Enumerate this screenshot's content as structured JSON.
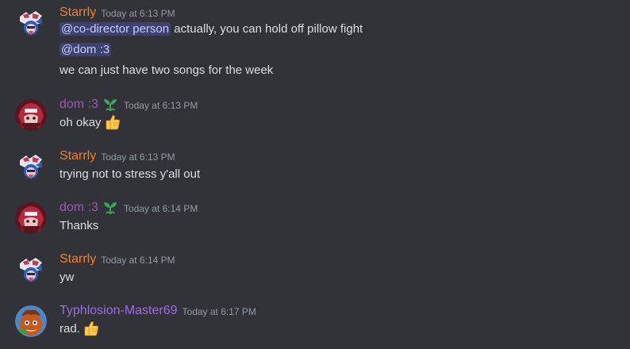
{
  "colors": {
    "starrly": "#f0822e",
    "dom": "#9b59b6",
    "typhlosion": "#9d6bf0",
    "leaf": "#3ba55d",
    "timestamp": "#949ba4"
  },
  "messages": [
    {
      "author": "Starrly",
      "time": "Today at 6:13 PM",
      "mention1": "@co-director person",
      "text1": " actually, you can hold off pillow fight",
      "mention2": "@dom :3",
      "text2": "we can just have two songs for the week"
    },
    {
      "author": "dom :3",
      "badge_icon": "leaf-icon",
      "time": "Today at 6:13 PM",
      "text": "oh okay",
      "emoji": "thumbs-up-icon"
    },
    {
      "author": "Starrly",
      "time": "Today at 6:13 PM",
      "text": "trying not to stress y'all out"
    },
    {
      "author": "dom :3",
      "badge_icon": "leaf-icon",
      "time": "Today at 6:14 PM",
      "text": "Thanks"
    },
    {
      "author": "Starrly",
      "time": "Today at 6:14 PM",
      "text": "yw"
    },
    {
      "author": "Typhlosion-Master69",
      "time": "Today at 6:17 PM",
      "text": "rad.",
      "emoji": "thumbs-up-icon"
    }
  ]
}
